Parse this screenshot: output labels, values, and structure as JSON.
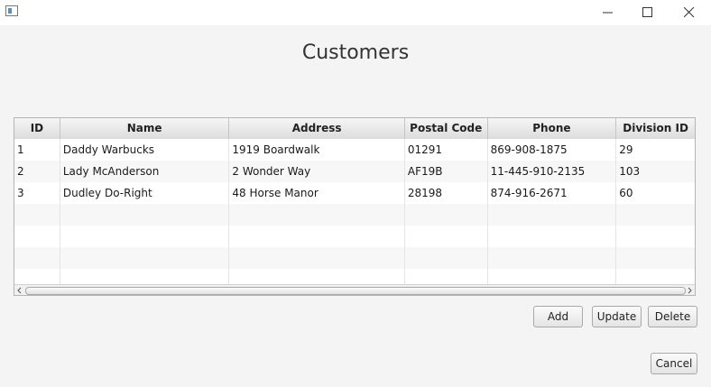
{
  "window": {
    "controls": {
      "minimize_icon": "minimize-icon",
      "maximize_icon": "maximize-icon",
      "close_icon": "close-icon"
    }
  },
  "header": {
    "title": "Customers"
  },
  "table": {
    "columns": [
      "ID",
      "Name",
      "Address",
      "Postal Code",
      "Phone",
      "Division ID"
    ],
    "rows": [
      [
        "1",
        "Daddy Warbucks",
        "1919 Boardwalk",
        "01291",
        "869-908-1875",
        "29"
      ],
      [
        "2",
        "Lady McAnderson",
        "2 Wonder Way",
        "AF19B",
        "11-445-910-2135",
        "103"
      ],
      [
        "3",
        "Dudley Do-Right",
        "48 Horse Manor",
        "28198",
        "874-916-2671",
        "60"
      ],
      [
        "",
        "",
        "",
        "",
        "",
        ""
      ],
      [
        "",
        "",
        "",
        "",
        "",
        ""
      ],
      [
        "",
        "",
        "",
        "",
        "",
        ""
      ],
      [
        "",
        "",
        "",
        "",
        "",
        ""
      ]
    ]
  },
  "actions": {
    "add_label": "Add",
    "update_label": "Update",
    "delete_label": "Delete",
    "cancel_label": "Cancel"
  },
  "colors": {
    "window_bg": "#f4f4f4",
    "header_gradient_top": "#f6f6f6",
    "header_gradient_bottom": "#dcdcdc",
    "border": "#b5b5b5"
  }
}
